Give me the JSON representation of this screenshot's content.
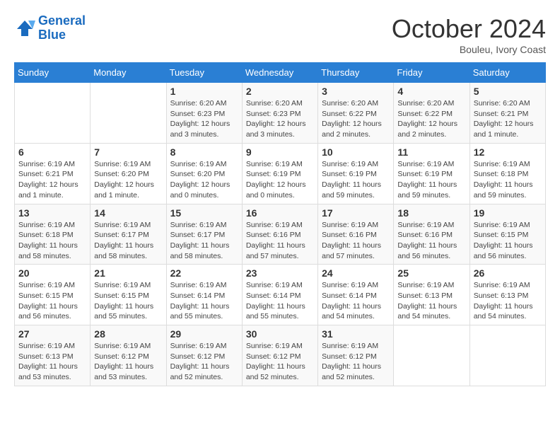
{
  "header": {
    "logo_line1": "General",
    "logo_line2": "Blue",
    "month": "October 2024",
    "location": "Bouleu, Ivory Coast"
  },
  "weekdays": [
    "Sunday",
    "Monday",
    "Tuesday",
    "Wednesday",
    "Thursday",
    "Friday",
    "Saturday"
  ],
  "weeks": [
    [
      {
        "day": "",
        "info": ""
      },
      {
        "day": "",
        "info": ""
      },
      {
        "day": "1",
        "info": "Sunrise: 6:20 AM\nSunset: 6:23 PM\nDaylight: 12 hours and 3 minutes."
      },
      {
        "day": "2",
        "info": "Sunrise: 6:20 AM\nSunset: 6:23 PM\nDaylight: 12 hours and 3 minutes."
      },
      {
        "day": "3",
        "info": "Sunrise: 6:20 AM\nSunset: 6:22 PM\nDaylight: 12 hours and 2 minutes."
      },
      {
        "day": "4",
        "info": "Sunrise: 6:20 AM\nSunset: 6:22 PM\nDaylight: 12 hours and 2 minutes."
      },
      {
        "day": "5",
        "info": "Sunrise: 6:20 AM\nSunset: 6:21 PM\nDaylight: 12 hours and 1 minute."
      }
    ],
    [
      {
        "day": "6",
        "info": "Sunrise: 6:19 AM\nSunset: 6:21 PM\nDaylight: 12 hours and 1 minute."
      },
      {
        "day": "7",
        "info": "Sunrise: 6:19 AM\nSunset: 6:20 PM\nDaylight: 12 hours and 1 minute."
      },
      {
        "day": "8",
        "info": "Sunrise: 6:19 AM\nSunset: 6:20 PM\nDaylight: 12 hours and 0 minutes."
      },
      {
        "day": "9",
        "info": "Sunrise: 6:19 AM\nSunset: 6:19 PM\nDaylight: 12 hours and 0 minutes."
      },
      {
        "day": "10",
        "info": "Sunrise: 6:19 AM\nSunset: 6:19 PM\nDaylight: 11 hours and 59 minutes."
      },
      {
        "day": "11",
        "info": "Sunrise: 6:19 AM\nSunset: 6:19 PM\nDaylight: 11 hours and 59 minutes."
      },
      {
        "day": "12",
        "info": "Sunrise: 6:19 AM\nSunset: 6:18 PM\nDaylight: 11 hours and 59 minutes."
      }
    ],
    [
      {
        "day": "13",
        "info": "Sunrise: 6:19 AM\nSunset: 6:18 PM\nDaylight: 11 hours and 58 minutes."
      },
      {
        "day": "14",
        "info": "Sunrise: 6:19 AM\nSunset: 6:17 PM\nDaylight: 11 hours and 58 minutes."
      },
      {
        "day": "15",
        "info": "Sunrise: 6:19 AM\nSunset: 6:17 PM\nDaylight: 11 hours and 58 minutes."
      },
      {
        "day": "16",
        "info": "Sunrise: 6:19 AM\nSunset: 6:16 PM\nDaylight: 11 hours and 57 minutes."
      },
      {
        "day": "17",
        "info": "Sunrise: 6:19 AM\nSunset: 6:16 PM\nDaylight: 11 hours and 57 minutes."
      },
      {
        "day": "18",
        "info": "Sunrise: 6:19 AM\nSunset: 6:16 PM\nDaylight: 11 hours and 56 minutes."
      },
      {
        "day": "19",
        "info": "Sunrise: 6:19 AM\nSunset: 6:15 PM\nDaylight: 11 hours and 56 minutes."
      }
    ],
    [
      {
        "day": "20",
        "info": "Sunrise: 6:19 AM\nSunset: 6:15 PM\nDaylight: 11 hours and 56 minutes."
      },
      {
        "day": "21",
        "info": "Sunrise: 6:19 AM\nSunset: 6:15 PM\nDaylight: 11 hours and 55 minutes."
      },
      {
        "day": "22",
        "info": "Sunrise: 6:19 AM\nSunset: 6:14 PM\nDaylight: 11 hours and 55 minutes."
      },
      {
        "day": "23",
        "info": "Sunrise: 6:19 AM\nSunset: 6:14 PM\nDaylight: 11 hours and 55 minutes."
      },
      {
        "day": "24",
        "info": "Sunrise: 6:19 AM\nSunset: 6:14 PM\nDaylight: 11 hours and 54 minutes."
      },
      {
        "day": "25",
        "info": "Sunrise: 6:19 AM\nSunset: 6:13 PM\nDaylight: 11 hours and 54 minutes."
      },
      {
        "day": "26",
        "info": "Sunrise: 6:19 AM\nSunset: 6:13 PM\nDaylight: 11 hours and 54 minutes."
      }
    ],
    [
      {
        "day": "27",
        "info": "Sunrise: 6:19 AM\nSunset: 6:13 PM\nDaylight: 11 hours and 53 minutes."
      },
      {
        "day": "28",
        "info": "Sunrise: 6:19 AM\nSunset: 6:12 PM\nDaylight: 11 hours and 53 minutes."
      },
      {
        "day": "29",
        "info": "Sunrise: 6:19 AM\nSunset: 6:12 PM\nDaylight: 11 hours and 52 minutes."
      },
      {
        "day": "30",
        "info": "Sunrise: 6:19 AM\nSunset: 6:12 PM\nDaylight: 11 hours and 52 minutes."
      },
      {
        "day": "31",
        "info": "Sunrise: 6:19 AM\nSunset: 6:12 PM\nDaylight: 11 hours and 52 minutes."
      },
      {
        "day": "",
        "info": ""
      },
      {
        "day": "",
        "info": ""
      }
    ]
  ]
}
